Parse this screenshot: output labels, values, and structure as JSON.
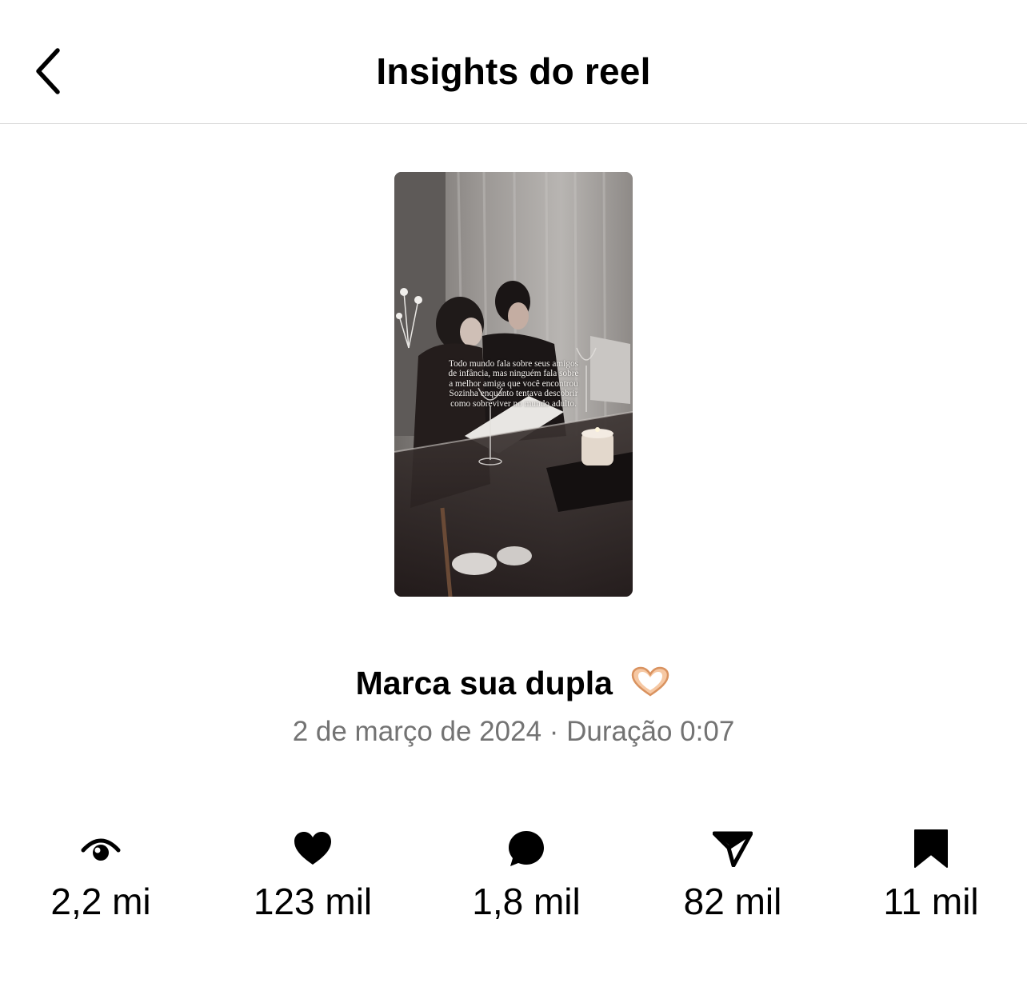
{
  "header": {
    "title": "Insights do reel",
    "back_icon": "chevron-left-icon"
  },
  "reel": {
    "thumbnail_overlay_lines": [
      "Todo mundo fala sobre seus amigos",
      "de infância, mas ninguém fala sobre",
      "a melhor amiga que você encontrou",
      "Sozinha enquanto tentava descobrir",
      "como sobreviver no mundo adulto."
    ],
    "title": "Marca sua dupla",
    "title_emoji": "heart-hands-emoji",
    "date": "2 de março de 2024",
    "separator": "·",
    "duration": "Duração 0:07"
  },
  "stats": [
    {
      "icon": "eye-icon",
      "value": "2,2 mi"
    },
    {
      "icon": "heart-icon",
      "value": "123 mil"
    },
    {
      "icon": "comment-icon",
      "value": "1,8 mil"
    },
    {
      "icon": "share-icon",
      "value": "82 mil"
    },
    {
      "icon": "bookmark-icon",
      "value": "11 mil"
    }
  ],
  "colors": {
    "text": "#000000",
    "secondary_text": "#737373",
    "divider": "#dcdcdc",
    "background": "#ffffff"
  }
}
